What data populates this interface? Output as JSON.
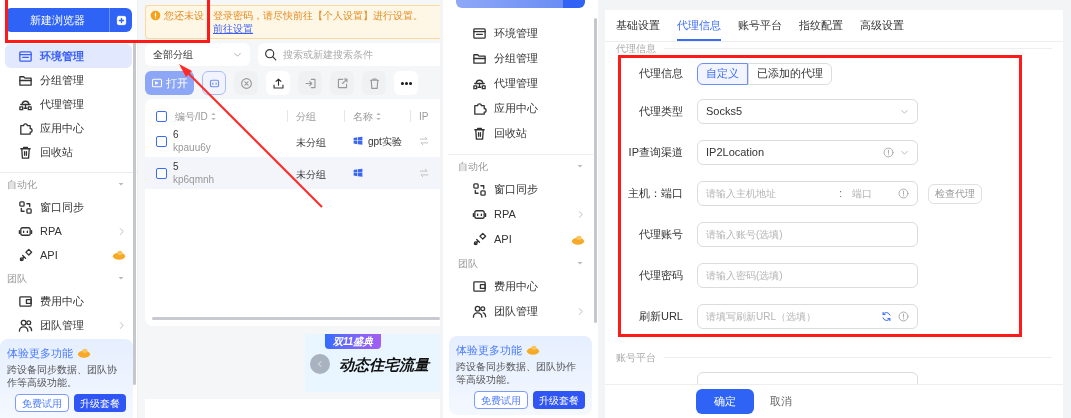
{
  "left_screen": {
    "sidebar": {
      "new_browser_button": "新建浏览器",
      "groups": [
        {
          "items": [
            {
              "label": "环境管理",
              "selected": true,
              "has_submenu": false,
              "vip": false
            },
            {
              "label": "分组管理",
              "selected": false,
              "has_submenu": false,
              "vip": false
            },
            {
              "label": "代理管理",
              "selected": false,
              "has_submenu": false,
              "vip": false
            },
            {
              "label": "应用中心",
              "selected": false,
              "has_submenu": false,
              "vip": false
            },
            {
              "label": "回收站",
              "selected": false,
              "has_submenu": false,
              "vip": false
            }
          ]
        },
        {
          "header": "自动化",
          "items": [
            {
              "label": "窗口同步",
              "selected": false,
              "has_submenu": false,
              "vip": false
            },
            {
              "label": "RPA",
              "selected": false,
              "has_submenu": true,
              "vip": false
            },
            {
              "label": "API",
              "selected": false,
              "has_submenu": false,
              "vip": true
            }
          ]
        },
        {
          "header": "团队",
          "items": [
            {
              "label": "费用中心",
              "selected": false,
              "has_submenu": false,
              "vip": false
            },
            {
              "label": "团队管理",
              "selected": false,
              "has_submenu": true,
              "vip": false
            }
          ]
        }
      ],
      "promo": {
        "title": "体验更多功能",
        "text": "跨设备同步数据、团队协作等高级功能。",
        "buttons": [
          "免费试用",
          "升级套餐"
        ]
      }
    },
    "main": {
      "alert": {
        "text_parts": [
          "您还未设",
          "登录密码，请尽快前往【个人设置】进行设置。"
        ],
        "link": "前往设置"
      },
      "group_filter": "全部分组",
      "search": {
        "placeholder": "搜索或新建搜索条件"
      },
      "toolbar": {
        "open_button": "打开"
      },
      "table": {
        "select_all_checked": false,
        "columns": [
          {
            "label": "编号/ID",
            "sortable": true
          },
          {
            "label": "分组",
            "sortable": false
          },
          {
            "label": "名称",
            "sortable": true
          },
          {
            "label": "IP",
            "sortable": false
          }
        ],
        "rows": [
          {
            "number": "6",
            "id": "kpauu6y",
            "group": "未分组",
            "name": "gpt实验",
            "checked": false,
            "hovered": false
          },
          {
            "number": "5",
            "id": "kp6qmnh",
            "group": "未分组",
            "checked": false,
            "hovered": true
          }
        ]
      },
      "banner": {
        "tag": "双11盛典",
        "title": "动态住宅流量"
      }
    }
  },
  "right_screen": {
    "sidebar": {
      "groups": [
        {
          "items": [
            {
              "label": "环境管理",
              "selected": false,
              "has_submenu": false,
              "vip": false
            },
            {
              "label": "分组管理",
              "selected": false,
              "has_submenu": false,
              "vip": false
            },
            {
              "label": "代理管理",
              "selected": false,
              "has_submenu": false,
              "vip": false
            },
            {
              "label": "应用中心",
              "selected": false,
              "has_submenu": false,
              "vip": false
            },
            {
              "label": "回收站",
              "selected": false,
              "has_submenu": false,
              "vip": false
            }
          ]
        },
        {
          "header": "自动化",
          "items": [
            {
              "label": "窗口同步",
              "selected": false,
              "has_submenu": false,
              "vip": false
            },
            {
              "label": "RPA",
              "selected": false,
              "has_submenu": true,
              "vip": false
            },
            {
              "label": "API",
              "selected": false,
              "has_submenu": false,
              "vip": true
            }
          ]
        },
        {
          "header": "团队",
          "items": [
            {
              "label": "费用中心",
              "selected": false,
              "has_submenu": false,
              "vip": false
            },
            {
              "label": "团队管理",
              "selected": false,
              "has_submenu": true,
              "vip": false
            }
          ]
        }
      ],
      "promo": {
        "title": "体验更多功能",
        "text": "跨设备同步数据、团队协作等高级功能。",
        "buttons": [
          "免费试用",
          "升级套餐"
        ]
      }
    },
    "form": {
      "tabs": [
        {
          "label": "基础设置",
          "selected": false
        },
        {
          "label": "代理信息",
          "selected": true
        },
        {
          "label": "账号平台",
          "selected": false
        },
        {
          "label": "指纹配置",
          "selected": false
        },
        {
          "label": "高级设置",
          "selected": false
        }
      ],
      "section": "代理信息",
      "fields": [
        {
          "kind": "segmented",
          "label": "代理信息",
          "options": [
            {
              "label": "自定义",
              "selected": true
            },
            {
              "label": "已添加的代理",
              "selected": false
            }
          ]
        },
        {
          "kind": "select",
          "label": "代理类型",
          "value": "Socks5",
          "info": false
        },
        {
          "kind": "select",
          "label": "IP查询渠道",
          "value": "IP2Location",
          "info": true
        },
        {
          "kind": "host_port",
          "label": "主机：端口",
          "host_placeholder": "请输入主机地址",
          "separator": ":",
          "port_placeholder": "端口",
          "button": "检查代理"
        },
        {
          "kind": "input",
          "label": "代理账号",
          "placeholder": "请输入账号(选填)"
        },
        {
          "kind": "input",
          "label": "代理密码",
          "placeholder": "请输入密码(选填)"
        },
        {
          "kind": "refresh_input",
          "label": "刷新URL",
          "placeholder": "请填写刷新URL（选填）"
        }
      ],
      "next_section": "账号平台",
      "footer": {
        "confirm": "确定",
        "cancel": "取消"
      }
    }
  }
}
